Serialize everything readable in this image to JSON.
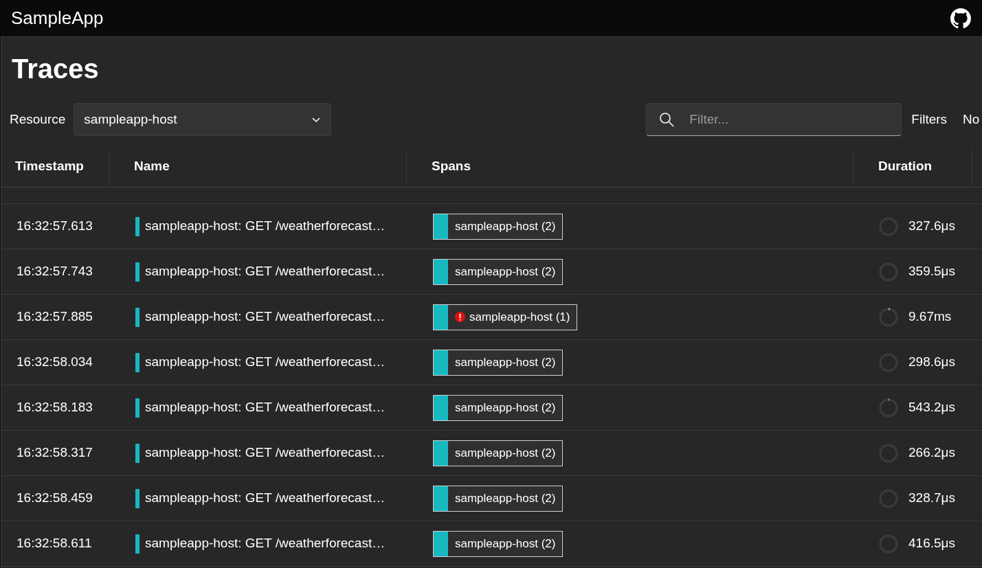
{
  "app_title": "SampleApp",
  "page_title": "Traces",
  "resource": {
    "label": "Resource",
    "value": "sampleapp-host"
  },
  "filter": {
    "placeholder": "Filter..."
  },
  "toolbar_buttons": [
    "Filters",
    "No"
  ],
  "table": {
    "columns": [
      "Timestamp",
      "Name",
      "Spans",
      "Duration"
    ],
    "rows": [
      {
        "timestamp": "16:32:57.613",
        "name": "sampleapp-host: GET /weatherforecast…",
        "span": "sampleapp-host (2)",
        "error": false,
        "level": 0,
        "duration": "327.6μs"
      },
      {
        "timestamp": "16:32:57.743",
        "name": "sampleapp-host: GET /weatherforecast…",
        "span": "sampleapp-host (2)",
        "error": false,
        "level": 0,
        "duration": "359.5μs"
      },
      {
        "timestamp": "16:32:57.885",
        "name": "sampleapp-host: GET /weatherforecast…",
        "span": "sampleapp-host (1)",
        "error": true,
        "level": 0.025,
        "duration": "9.67ms"
      },
      {
        "timestamp": "16:32:58.034",
        "name": "sampleapp-host: GET /weatherforecast…",
        "span": "sampleapp-host (2)",
        "error": false,
        "level": 0,
        "duration": "298.6μs"
      },
      {
        "timestamp": "16:32:58.183",
        "name": "sampleapp-host: GET /weatherforecast…",
        "span": "sampleapp-host (2)",
        "error": false,
        "level": 0.008,
        "duration": "543.2μs"
      },
      {
        "timestamp": "16:32:58.317",
        "name": "sampleapp-host: GET /weatherforecast…",
        "span": "sampleapp-host (2)",
        "error": false,
        "level": 0,
        "duration": "266.2μs"
      },
      {
        "timestamp": "16:32:58.459",
        "name": "sampleapp-host: GET /weatherforecast…",
        "span": "sampleapp-host (2)",
        "error": false,
        "level": 0,
        "duration": "328.7μs"
      },
      {
        "timestamp": "16:32:58.611",
        "name": "sampleapp-host: GET /weatherforecast…",
        "span": "sampleapp-host (2)",
        "error": false,
        "level": 0,
        "duration": "416.5μs"
      }
    ]
  }
}
